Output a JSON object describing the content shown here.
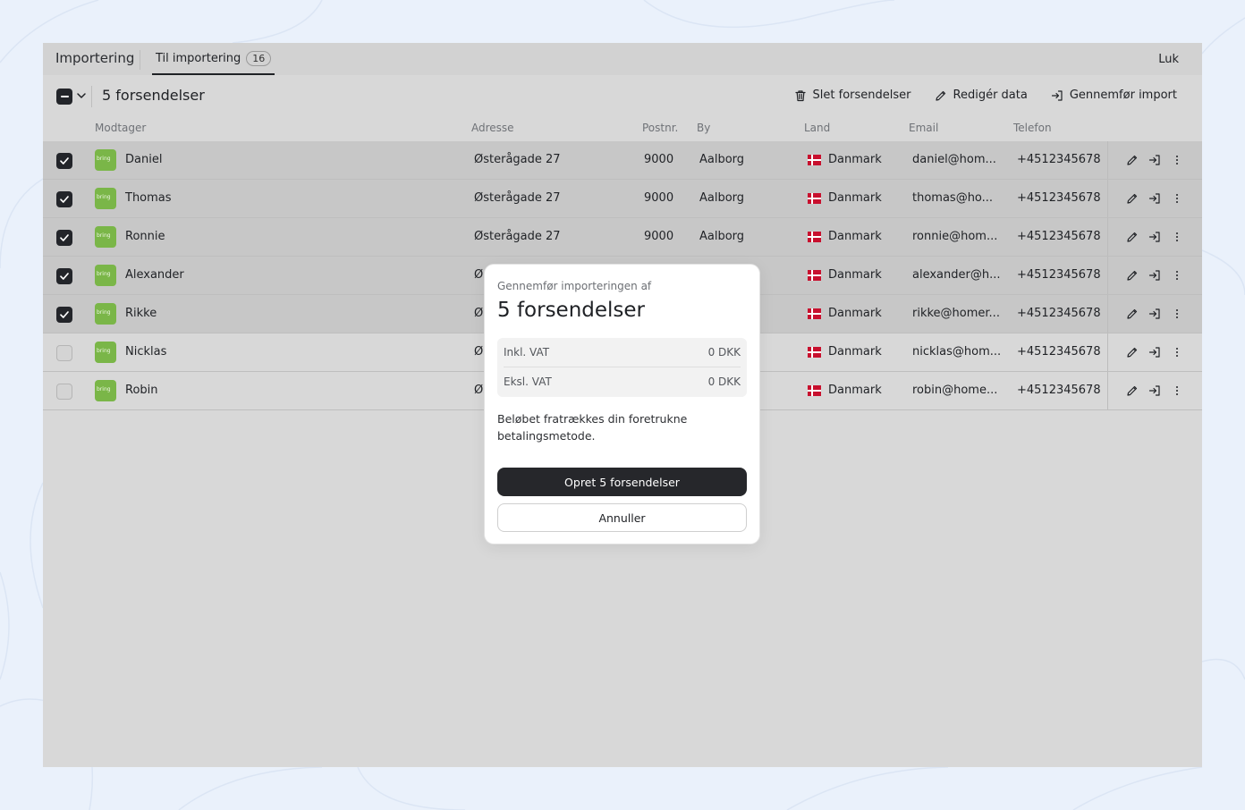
{
  "tabs": {
    "main": "Importering",
    "active_label": "Til importering",
    "active_badge": "16",
    "close": "Luk"
  },
  "toolbar": {
    "selected_count": "5 forsendelser",
    "delete": "Slet forsendelser",
    "edit": "Redigér data",
    "import": "Gennemfør import"
  },
  "columns": {
    "recipient": "Modtager",
    "address": "Adresse",
    "postal": "Postnr.",
    "city": "By",
    "country": "Land",
    "email": "Email",
    "phone": "Telefon"
  },
  "carrier_logo_text": "bring",
  "rows": [
    {
      "selected": true,
      "name": "Daniel",
      "address": "Østerågade 27",
      "postal": "9000",
      "city": "Aalborg",
      "country": "Danmark",
      "email": "daniel@hom...",
      "phone": "+4512345678"
    },
    {
      "selected": true,
      "name": "Thomas",
      "address": "Østerågade 27",
      "postal": "9000",
      "city": "Aalborg",
      "country": "Danmark",
      "email": "thomas@ho...",
      "phone": "+4512345678"
    },
    {
      "selected": true,
      "name": "Ronnie",
      "address": "Østerågade 27",
      "postal": "9000",
      "city": "Aalborg",
      "country": "Danmark",
      "email": "ronnie@hom...",
      "phone": "+4512345678"
    },
    {
      "selected": true,
      "name": "Alexander",
      "address": "Øs",
      "postal": "",
      "city": "",
      "country": "Danmark",
      "email": "alexander@h...",
      "phone": "+4512345678"
    },
    {
      "selected": true,
      "name": "Rikke",
      "address": "Øs",
      "postal": "",
      "city": "",
      "country": "Danmark",
      "email": "rikke@homer...",
      "phone": "+4512345678"
    },
    {
      "selected": false,
      "name": "Nicklas",
      "address": "Øs",
      "postal": "",
      "city": "",
      "country": "Danmark",
      "email": "nicklas@hom...",
      "phone": "+4512345678"
    },
    {
      "selected": false,
      "name": "Robin",
      "address": "Øs",
      "postal": "",
      "city": "",
      "country": "Danmark",
      "email": "robin@home...",
      "phone": "+4512345678"
    }
  ],
  "modal": {
    "subtitle": "Gennemfør importeringen af",
    "title": "5 forsendelser",
    "incl_label": "Inkl. VAT",
    "incl_value": "0 DKK",
    "excl_label": "Eksl. VAT",
    "excl_value": "0 DKK",
    "note": "Beløbet fratrækkes din foretrukne betalingsmetode.",
    "confirm": "Opret 5 forsendelser",
    "cancel": "Annuller"
  },
  "colors": {
    "background": "#eaf1fb",
    "carrier_green": "#7ab648",
    "primary_button": "#26272b",
    "flag_red": "#c8102e"
  }
}
